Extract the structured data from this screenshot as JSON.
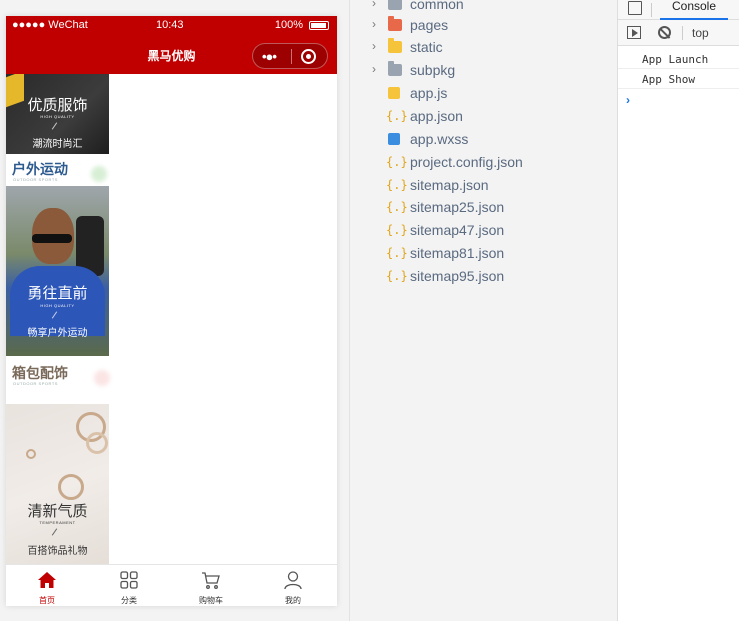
{
  "phone": {
    "status": {
      "carrier": "●●●●● WeChat",
      "time": "10:43",
      "battery": "100%"
    },
    "nav_title": "黑马优购",
    "capsule": {
      "more_icon": "more-dots-icon",
      "close_icon": "target-icon"
    },
    "sections": [
      {
        "big": "优质服饰",
        "small": "HIGH QUALITY",
        "sub": "潮流时尚汇"
      },
      {
        "cat": "户外运动",
        "cat_en": "OUTDOOR SPORTS",
        "big": "勇往直前",
        "small": "HIGH QUALITY",
        "sub": "畅享户外运动"
      },
      {
        "cat": "箱包配饰",
        "cat_en": "OUTDOOR SPORTS",
        "big": "清新气质",
        "small": "TEMPERAMENT",
        "sub": "百搭饰品礼物"
      }
    ],
    "tabbar": [
      {
        "label": "首页",
        "icon": "home-icon",
        "active": true
      },
      {
        "label": "分类",
        "icon": "grid-icon",
        "active": false
      },
      {
        "label": "购物车",
        "icon": "cart-icon",
        "active": false
      },
      {
        "label": "我的",
        "icon": "user-icon",
        "active": false
      }
    ],
    "colors": {
      "brand": "#c00000"
    }
  },
  "explorer": {
    "items": [
      {
        "label": "common",
        "type": "folder",
        "color": "#9aa4b0"
      },
      {
        "label": "pages",
        "type": "folder",
        "color": "#e8684a"
      },
      {
        "label": "static",
        "type": "folder",
        "color": "#f5c43a"
      },
      {
        "label": "subpkg",
        "type": "folder",
        "color": "#9aa4b0"
      },
      {
        "label": "app.js",
        "type": "js"
      },
      {
        "label": "app.json",
        "type": "json"
      },
      {
        "label": "app.wxss",
        "type": "wxss"
      },
      {
        "label": "project.config.json",
        "type": "json"
      },
      {
        "label": "sitemap.json",
        "type": "json"
      },
      {
        "label": "sitemap25.json",
        "type": "json"
      },
      {
        "label": "sitemap47.json",
        "type": "json"
      },
      {
        "label": "sitemap81.json",
        "type": "json"
      },
      {
        "label": "sitemap95.json",
        "type": "json"
      }
    ]
  },
  "console": {
    "tab": "Console",
    "context": "top",
    "lines": [
      "App Launch",
      "App Show"
    ],
    "prompt": "›"
  }
}
